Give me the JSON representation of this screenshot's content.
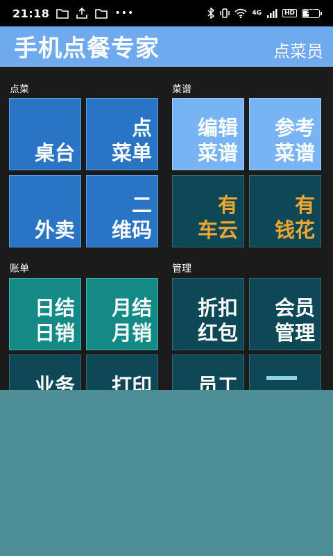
{
  "status": {
    "time": "21:18",
    "network": "4G",
    "hd": "HD",
    "battery": "39",
    "battery_level": 0.39
  },
  "header": {
    "title": "手机点餐专家",
    "role": "点菜员"
  },
  "sections": {
    "order": {
      "label": "点菜"
    },
    "menu": {
      "label": "菜谱"
    },
    "bill": {
      "label": "账单"
    },
    "manage": {
      "label": "管理"
    }
  },
  "tiles": {
    "table": [
      "",
      "桌台"
    ],
    "order_list": [
      "点",
      "菜单"
    ],
    "takeout": [
      "",
      "外卖"
    ],
    "qrcode": [
      "二",
      "维码"
    ],
    "edit_menu": [
      "编辑",
      "菜谱"
    ],
    "ref_menu": [
      "参考",
      "菜谱"
    ],
    "car_cloud": [
      "有",
      "车云"
    ],
    "money_flower": [
      "有",
      "钱花"
    ],
    "daily": [
      "日结",
      "日销"
    ],
    "monthly": [
      "月结",
      "月销"
    ],
    "discount": [
      "折扣",
      "红包"
    ],
    "member": [
      "会员",
      "管理"
    ],
    "business": [
      "业务"
    ],
    "print": [
      "打印"
    ],
    "staff": [
      "员工"
    ]
  },
  "colors": {
    "title_bar": "#6fa9ee",
    "tile_blue": "#2a74c5",
    "tile_light": "#78b4f3",
    "tile_dark": "#0e4756",
    "tile_teal": "#138a85",
    "accent_orange": "#f1a62f",
    "overlay": "#4d8d96"
  }
}
